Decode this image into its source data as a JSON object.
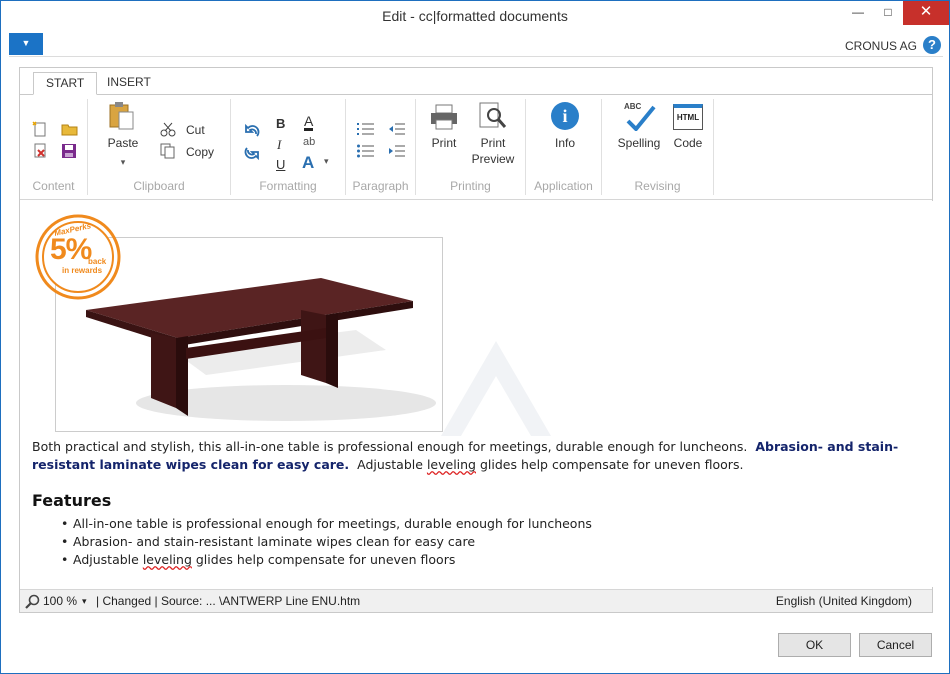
{
  "window": {
    "title": "Edit - cc|formatted documents",
    "minimize_glyph": "—",
    "maximize_glyph": "□",
    "close_glyph": "✕"
  },
  "topstrip": {
    "menu_glyph": "▼",
    "company": "CRONUS AG",
    "help_glyph": "?"
  },
  "tabs": [
    {
      "label": "START",
      "active": true
    },
    {
      "label": "INSERT",
      "active": false
    }
  ],
  "ribbon": {
    "groups": {
      "content": "Content",
      "clipboard": "Clipboard",
      "formatting": "Formatting",
      "paragraph": "Paragraph",
      "printing": "Printing",
      "application": "Application",
      "revising": "Revising"
    },
    "paste_label": "Paste",
    "paste_arrow": "▾",
    "cut_label": "Cut",
    "copy_label": "Copy",
    "bold_glyph": "B",
    "italic_glyph": "I",
    "underline_glyph": "U",
    "fontcolor_glyph": "A",
    "highlight_glyph": "ab",
    "fontsize_glyph": "A",
    "fontsize_arrow": "▾",
    "print_label": "Print",
    "print_preview_label_1": "Print",
    "print_preview_label_2": "Preview",
    "info_label": "Info",
    "info_glyph": "i",
    "spelling_label": "Spelling",
    "spelling_icon_text": "ABC",
    "code_label": "Code",
    "code_icon_text": "HTML"
  },
  "badge": {
    "brand": "MaxPerks",
    "percent": "5%",
    "line1": "back",
    "line2": "in rewards"
  },
  "document": {
    "para_1": "Both practical and stylish, this all-in-one table is professional enough for meetings, durable enough for luncheons.",
    "para_bold": "Abrasion- and stain-resistant laminate wipes clean for easy care.",
    "para_3a": "Adjustable",
    "para_3b": "leveling",
    "para_3c": "glides help compensate for uneven floors.",
    "features_heading": "Features",
    "features": [
      "All-in-one table is professional enough for meetings, durable enough for luncheons",
      "Abrasion- and stain-resistant laminate wipes clean for easy care"
    ],
    "feature_3a": "Adjustable",
    "feature_3b": "leveling",
    "feature_3c": "glides help compensate for uneven floors"
  },
  "status": {
    "zoom": "100 %",
    "zoom_arrow": "▾",
    "changed": "| Changed |",
    "source": "Source: ... \\ANTWERP Line ENU.htm",
    "language": "English (United Kingdom)"
  },
  "footer": {
    "ok": "OK",
    "cancel": "Cancel"
  },
  "colors": {
    "accent": "#1b73c6",
    "close": "#c7302b",
    "badge_orange": "#f08a1d",
    "link_bold": "#14246b",
    "table_wood": "#4a1b1b"
  }
}
